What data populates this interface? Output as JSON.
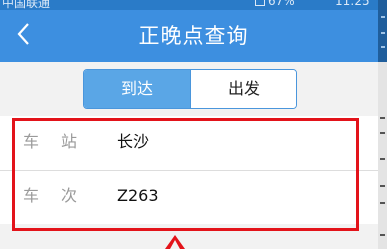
{
  "status_bar": {
    "carrier": "中国联通",
    "battery": "67%",
    "time": "11:25"
  },
  "header": {
    "back_icon": "chevron-left",
    "title": "正晚点查询"
  },
  "mode_tabs": [
    {
      "label": "到达",
      "selected": true
    },
    {
      "label": "出发",
      "selected": false
    }
  ],
  "form": {
    "station": {
      "label": "车站",
      "value": "长沙"
    },
    "train": {
      "label": "车次",
      "value": "Z263"
    }
  },
  "colors": {
    "nav_blue": "#3d8fe0",
    "tab_active": "#5aa6e6",
    "highlight_red": "#e3131a"
  }
}
